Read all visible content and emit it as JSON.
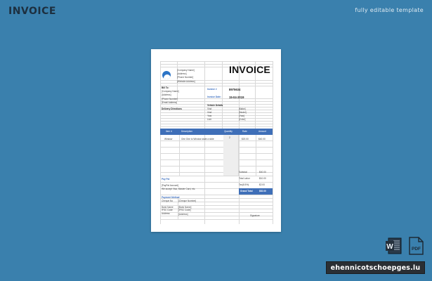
{
  "header": {
    "title": "INVOICE",
    "subtitle": "fully editable template"
  },
  "invoice": {
    "title": "INVOICE",
    "company": [
      "[Company Name]",
      "[Address]",
      "[Phone Number]",
      "[Website Address]"
    ],
    "bill_to_label": "Bill To:",
    "bill_to": [
      "[Company Name]",
      "[Address]",
      "[Phone Number]",
      "[Email Address]"
    ],
    "invoice_no_label": "Invoice #",
    "invoice_no": "8975634",
    "invoice_date_label": "Invoice Date:",
    "invoice_date": "15-04-2019",
    "delivery_label": "Delivery Directions",
    "vehicle_label": "Vehicle Details",
    "vehicle": [
      {
        "k": "Vin#",
        "v": "[Make]"
      },
      {
        "k": "Vin#",
        "v": "[Model]"
      },
      {
        "k": "Year",
        "v": "[Year]"
      },
      {
        "k": "Lic#",
        "v": "[Color]"
      }
    ],
    "table_headers": {
      "item": "Item #",
      "desc": "Description",
      "qty": "Quantity",
      "rate": "Rate",
      "amount": "Amount"
    },
    "row": {
      "item": "Window",
      "desc": "One One to Window state a slide",
      "qty": "2",
      "rate": "$20.00",
      "amount": "$40.00"
    },
    "pay_to_label": "Pay Pal",
    "pay_to": [
      "[PayPal Account]",
      "We accept Visa, Master Card, etc."
    ],
    "subtotal_label": "Subtotal",
    "subtotal": "$40.00",
    "total_label": "Total Labor",
    "total": "$10.00",
    "tax_label": "Tax(8.5%)",
    "tax": "$2.00",
    "grand_label": "Grand Total",
    "grand": "$52.00",
    "payment_label": "Payment Method",
    "payment": [
      {
        "k": "Cheque No",
        "v": "[Cheque Number]"
      },
      {
        "k": "Bank Name",
        "v": "[Bank Name]"
      },
      {
        "k": "IFSC Code",
        "v": "[IFSC Code]"
      },
      {
        "k": "Address",
        "v": "[Address]"
      }
    ],
    "signature_label": "Signature"
  },
  "badge": "ehennicotschoepges.lu",
  "icons": {
    "word": "word-document-icon",
    "pdf": "pdf-document-icon"
  }
}
